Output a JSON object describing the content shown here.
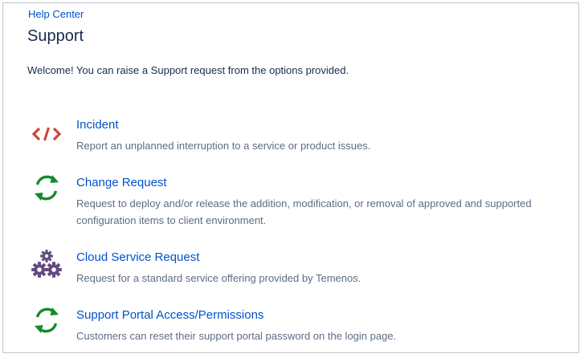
{
  "breadcrumb": {
    "label": "Help Center"
  },
  "page": {
    "title": "Support",
    "welcome": "Welcome! You can raise a Support request from the options provided."
  },
  "request_types": [
    {
      "title": "Incident",
      "description": "Report an unplanned interruption to a service or product issues.",
      "icon": "code-icon",
      "color": "#d04437"
    },
    {
      "title": "Change Request",
      "description": "Request to deploy and/or release the addition, modification, or removal of approved and supported configuration items to client environment.",
      "icon": "refresh-icon",
      "color": "#14892c"
    },
    {
      "title": "Cloud Service Request",
      "description": "Request for a standard service offering provided by Temenos.",
      "icon": "gears-icon",
      "color": "#654982"
    },
    {
      "title": "Support Portal Access/Permissions",
      "description": "Customers can reset their support portal password on the login page.",
      "icon": "refresh-icon",
      "color": "#14892c"
    }
  ],
  "colors": {
    "link": "#0052cc",
    "text": "#172b4d",
    "muted": "#5e6c84",
    "border": "#c1c7d0"
  }
}
